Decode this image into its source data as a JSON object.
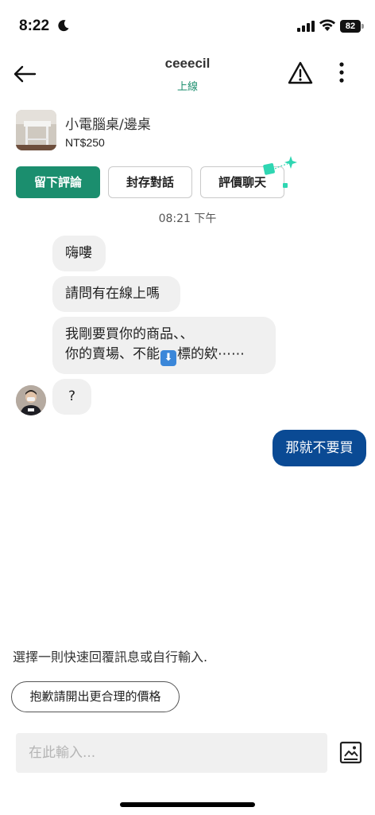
{
  "status_bar": {
    "time": "8:22",
    "battery": "82",
    "icons": [
      "moon-icon",
      "cellular-signal-icon",
      "wifi-icon",
      "battery-icon"
    ]
  },
  "header": {
    "contact_name": "ceeecil",
    "contact_status": "上線",
    "icons": [
      "back-arrow-icon",
      "warning-icon",
      "more-vertical-icon"
    ]
  },
  "listing": {
    "title": "小電腦桌/邊桌",
    "price": "NT$250"
  },
  "actions": {
    "leave_review": "留下評論",
    "archive_chat": "封存對話",
    "rate_chat": "評價聊天"
  },
  "chat": {
    "timestamp": "08:21 下午",
    "incoming": [
      {
        "text": "嗨嘍"
      },
      {
        "text": "請問有在線上嗎"
      },
      {
        "line1": "我剛要買你的商品、、",
        "line2_before": "你的賣場、不能",
        "emoji": "⬇",
        "line2_after": "標的欸⋯⋯"
      },
      {
        "text": "?"
      }
    ],
    "outgoing": [
      {
        "text": "那就不要買"
      }
    ]
  },
  "quick_reply": {
    "hint": "選擇一則快速回覆訊息或自行輸入.",
    "options": [
      "抱歉請開出更合理的價格"
    ]
  },
  "composer": {
    "placeholder": "在此輸入..."
  },
  "colors": {
    "accent_green": "#1b8e6e",
    "outgoing_bubble": "#0a4a94",
    "incoming_bubble": "#f0f0f0"
  }
}
